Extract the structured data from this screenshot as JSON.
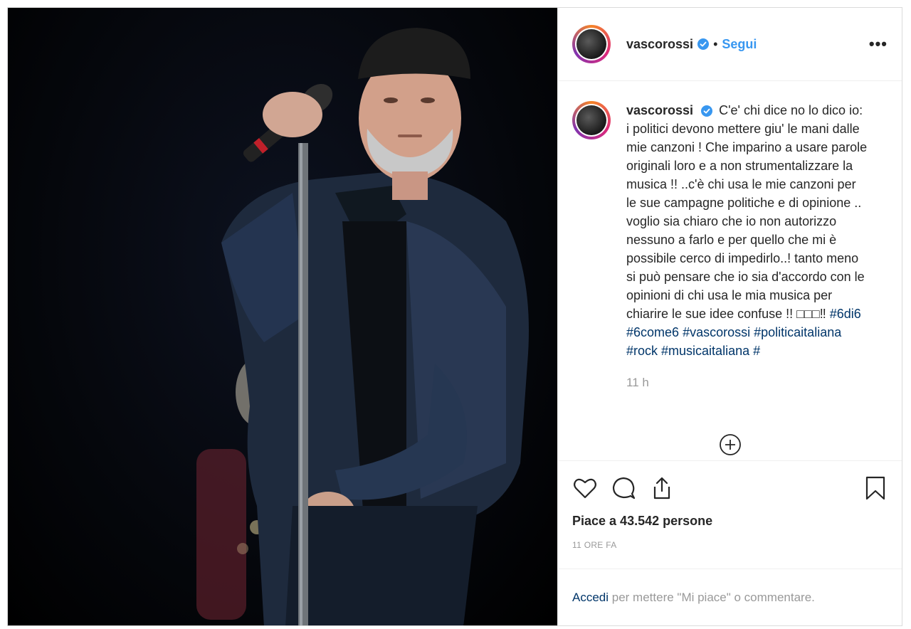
{
  "post": {
    "username": "vascorossi",
    "dot": "•",
    "follow_label": "Segui",
    "more_label": "•••",
    "caption": {
      "username": "vascorossi",
      "text": "C'e' chi dice no lo dico io: i politici devono mettere giu' le mani dalle mie canzoni ! Che imparino a usare parole originali loro e a non strumentalizzare la musica !! ..c'è chi usa le mie canzoni per le sue campagne politiche e di opinione .. voglio sia chiaro che io non autorizzo nessuno a farlo e per quello che mi è possibile cerco di impedirlo..! tanto meno si può pensare che io sia d'accordo con le opinioni di chi usa le mia musica per chiarire le sue idee confuse !! □□□‼",
      "hashtags": [
        "#6di6",
        "#6come6",
        "#vascorossi",
        "#politicaitaliana",
        "#rock",
        "#musicaitaliana",
        "#"
      ]
    },
    "time_ago": "11 h",
    "likes_text": "Piace a 43.542 persone",
    "date_text": "11 ORE FA",
    "login_link": "Accedi",
    "login_rest": " per mettere \"Mi piace\" o commentare."
  },
  "icons": {
    "verified": "verified-badge-icon",
    "like": "heart-icon",
    "comment": "comment-icon",
    "share": "share-icon",
    "save": "bookmark-icon",
    "load_more": "plus-circle-icon"
  },
  "colors": {
    "link_blue": "#3897f0",
    "hashtag": "#003569",
    "muted": "#999999",
    "text": "#262626"
  }
}
